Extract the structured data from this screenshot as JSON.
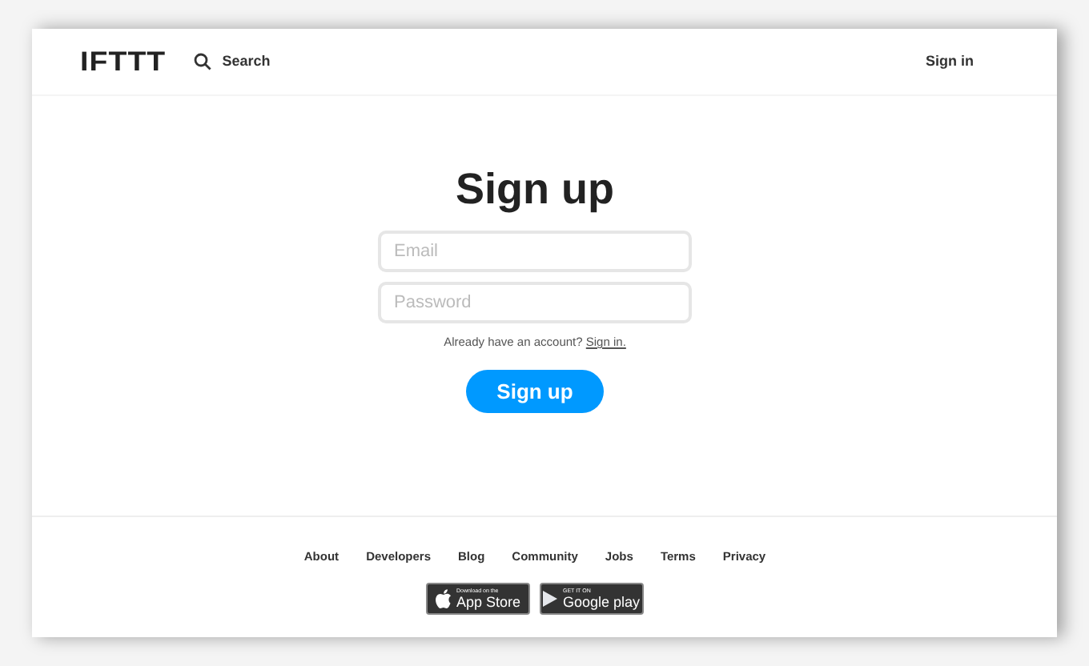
{
  "header": {
    "logo": "IFTTT",
    "search": "Search",
    "sign_in": "Sign in"
  },
  "form": {
    "title": "Sign up",
    "fields": [
      {
        "placeholder": "Email"
      },
      {
        "placeholder": "Password"
      }
    ],
    "account_prompt": "Already have an account?",
    "sign_in_link": "Sign in.",
    "submit": "Sign up"
  },
  "footer": {
    "links": [
      "About",
      "Developers",
      "Blog",
      "Community",
      "Jobs",
      "Terms",
      "Privacy"
    ],
    "badges": [
      {
        "kind": "apple",
        "small": "Download on the",
        "big": "App Store"
      },
      {
        "kind": "google",
        "small": "GET IT ON",
        "big": "Google play"
      }
    ]
  }
}
